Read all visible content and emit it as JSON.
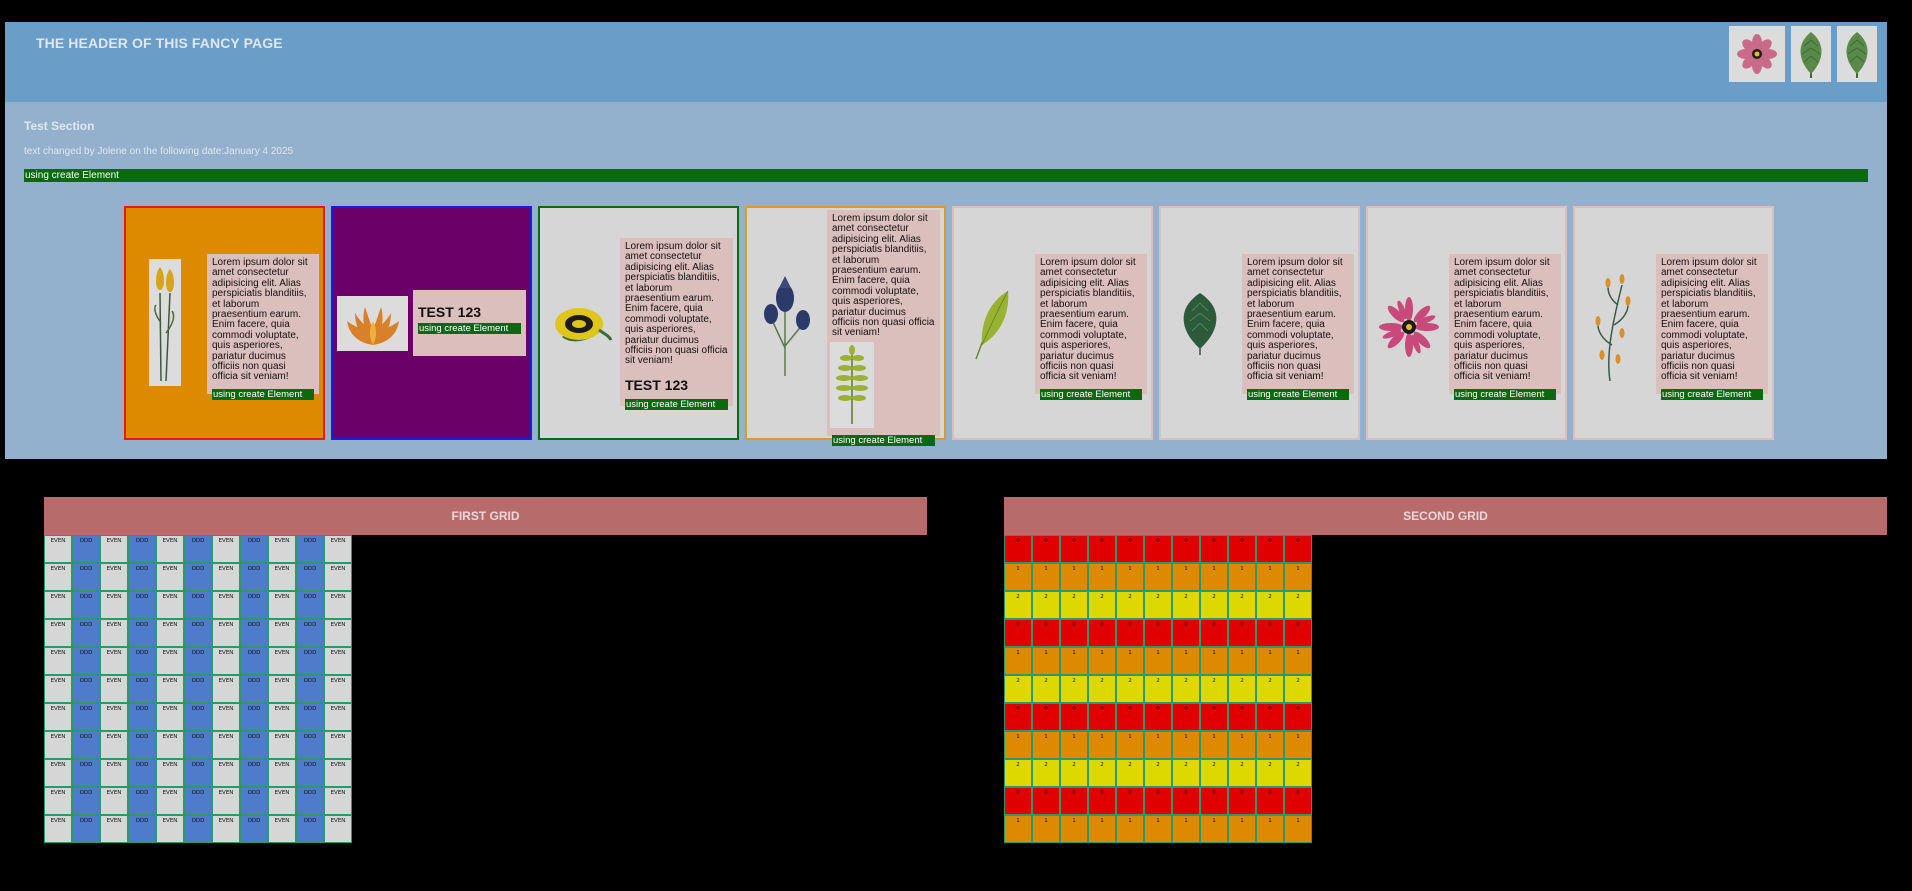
{
  "header": {
    "title": "THE HEADER OF THIS FANCY PAGE",
    "icons": [
      "flower-icon",
      "leaf-icon",
      "leaf-icon"
    ]
  },
  "section": {
    "title": "Test Section",
    "subtitle": "text changed by Jolene on the following date:January 4 2025",
    "green_bar_label": "using create Element"
  },
  "cards": [
    {
      "bg": "#de8a00",
      "border": "#e01b1b",
      "image": "tulip-flowers-icon",
      "lorem": "Lorem ipsum dolor sit amet consectetur adipisicing elit. Alias perspiciatis blanditiis, et laborum praesentium earum. Enim facere, quia commodi voluptate, quis asperiores, pariatur ducimus officiis non quasi officia sit veniam!",
      "test": "",
      "create_label": "using create Element"
    },
    {
      "bg": "#6b0068",
      "border": "#1b1bd9",
      "image": "orange-flower-icon",
      "lorem": "",
      "test": "TEST 123",
      "create_label": "using create Element"
    },
    {
      "bg": "#d6d6d6",
      "border": "#0b6a10",
      "image": "yellow-rose-icon",
      "lorem": "Lorem ipsum dolor sit amet consectetur adipisicing elit. Alias perspiciatis blanditiis, et laborum praesentium earum. Enim facere, quia commodi voluptate, quis asperiores, pariatur ducimus officiis non quasi officia sit veniam!",
      "test": "TEST 123",
      "create_label": "using create Element"
    },
    {
      "bg": "#d6d6d6",
      "border": "#de9a2a",
      "image": "blue-buds-icon",
      "lorem": "Lorem ipsum dolor sit amet consectetur adipisicing elit. Alias perspiciatis blanditiis, et laborum praesentium earum. Enim facere, quia commodi voluptate, quis asperiores, pariatur ducimus officiis non quasi officia sit veniam!",
      "test": "",
      "create_label": "using create Element"
    },
    {
      "bg": "#d6d6d6",
      "border": "#dbbfbd",
      "image": "green-leaf-icon",
      "lorem": "Lorem ipsum dolor sit amet consectetur adipisicing elit. Alias perspiciatis blanditiis, et laborum praesentium earum. Enim facere, quia commodi voluptate, quis asperiores, pariatur ducimus officiis non quasi officia sit veniam!",
      "test": "",
      "create_label": "using create Element"
    },
    {
      "bg": "#d6d6d6",
      "border": "#dbbfbd",
      "image": "dark-leaf-icon",
      "lorem": "Lorem ipsum dolor sit amet consectetur adipisicing elit. Alias perspiciatis blanditiis, et laborum praesentium earum. Enim facere, quia commodi voluptate, quis asperiores, pariatur ducimus officiis non quasi officia sit veniam!",
      "test": "",
      "create_label": "using create Element"
    },
    {
      "bg": "#d6d6d6",
      "border": "#dbbfbd",
      "image": "pink-daisy-icon",
      "lorem": "Lorem ipsum dolor sit amet consectetur adipisicing elit. Alias perspiciatis blanditiis, et laborum praesentium earum. Enim facere, quia commodi voluptate, quis asperiores, pariatur ducimus officiis non quasi officia sit veniam!",
      "test": "",
      "create_label": "using create Element"
    },
    {
      "bg": "#d6d6d6",
      "border": "#dbbfbd",
      "image": "orange-sprig-icon",
      "lorem": "Lorem ipsum dolor sit amet consectetur adipisicing elit. Alias perspiciatis blanditiis, et laborum praesentium earum. Enim facere, quia commodi voluptate, quis asperiores, pariatur ducimus officiis non quasi officia sit veniam!",
      "test": "",
      "create_label": "using create Element"
    }
  ],
  "grids": {
    "first": {
      "title": "FIRST GRID",
      "labels": [
        "EVEN",
        "ODD"
      ],
      "colors": [
        "#d6d6d6",
        "#4f7bcb"
      ]
    },
    "second": {
      "title": "SECOND GRID",
      "labels": [
        "0",
        "1",
        "2"
      ],
      "colors": [
        "#e00000",
        "#de8a00",
        "#dcd800"
      ]
    }
  }
}
